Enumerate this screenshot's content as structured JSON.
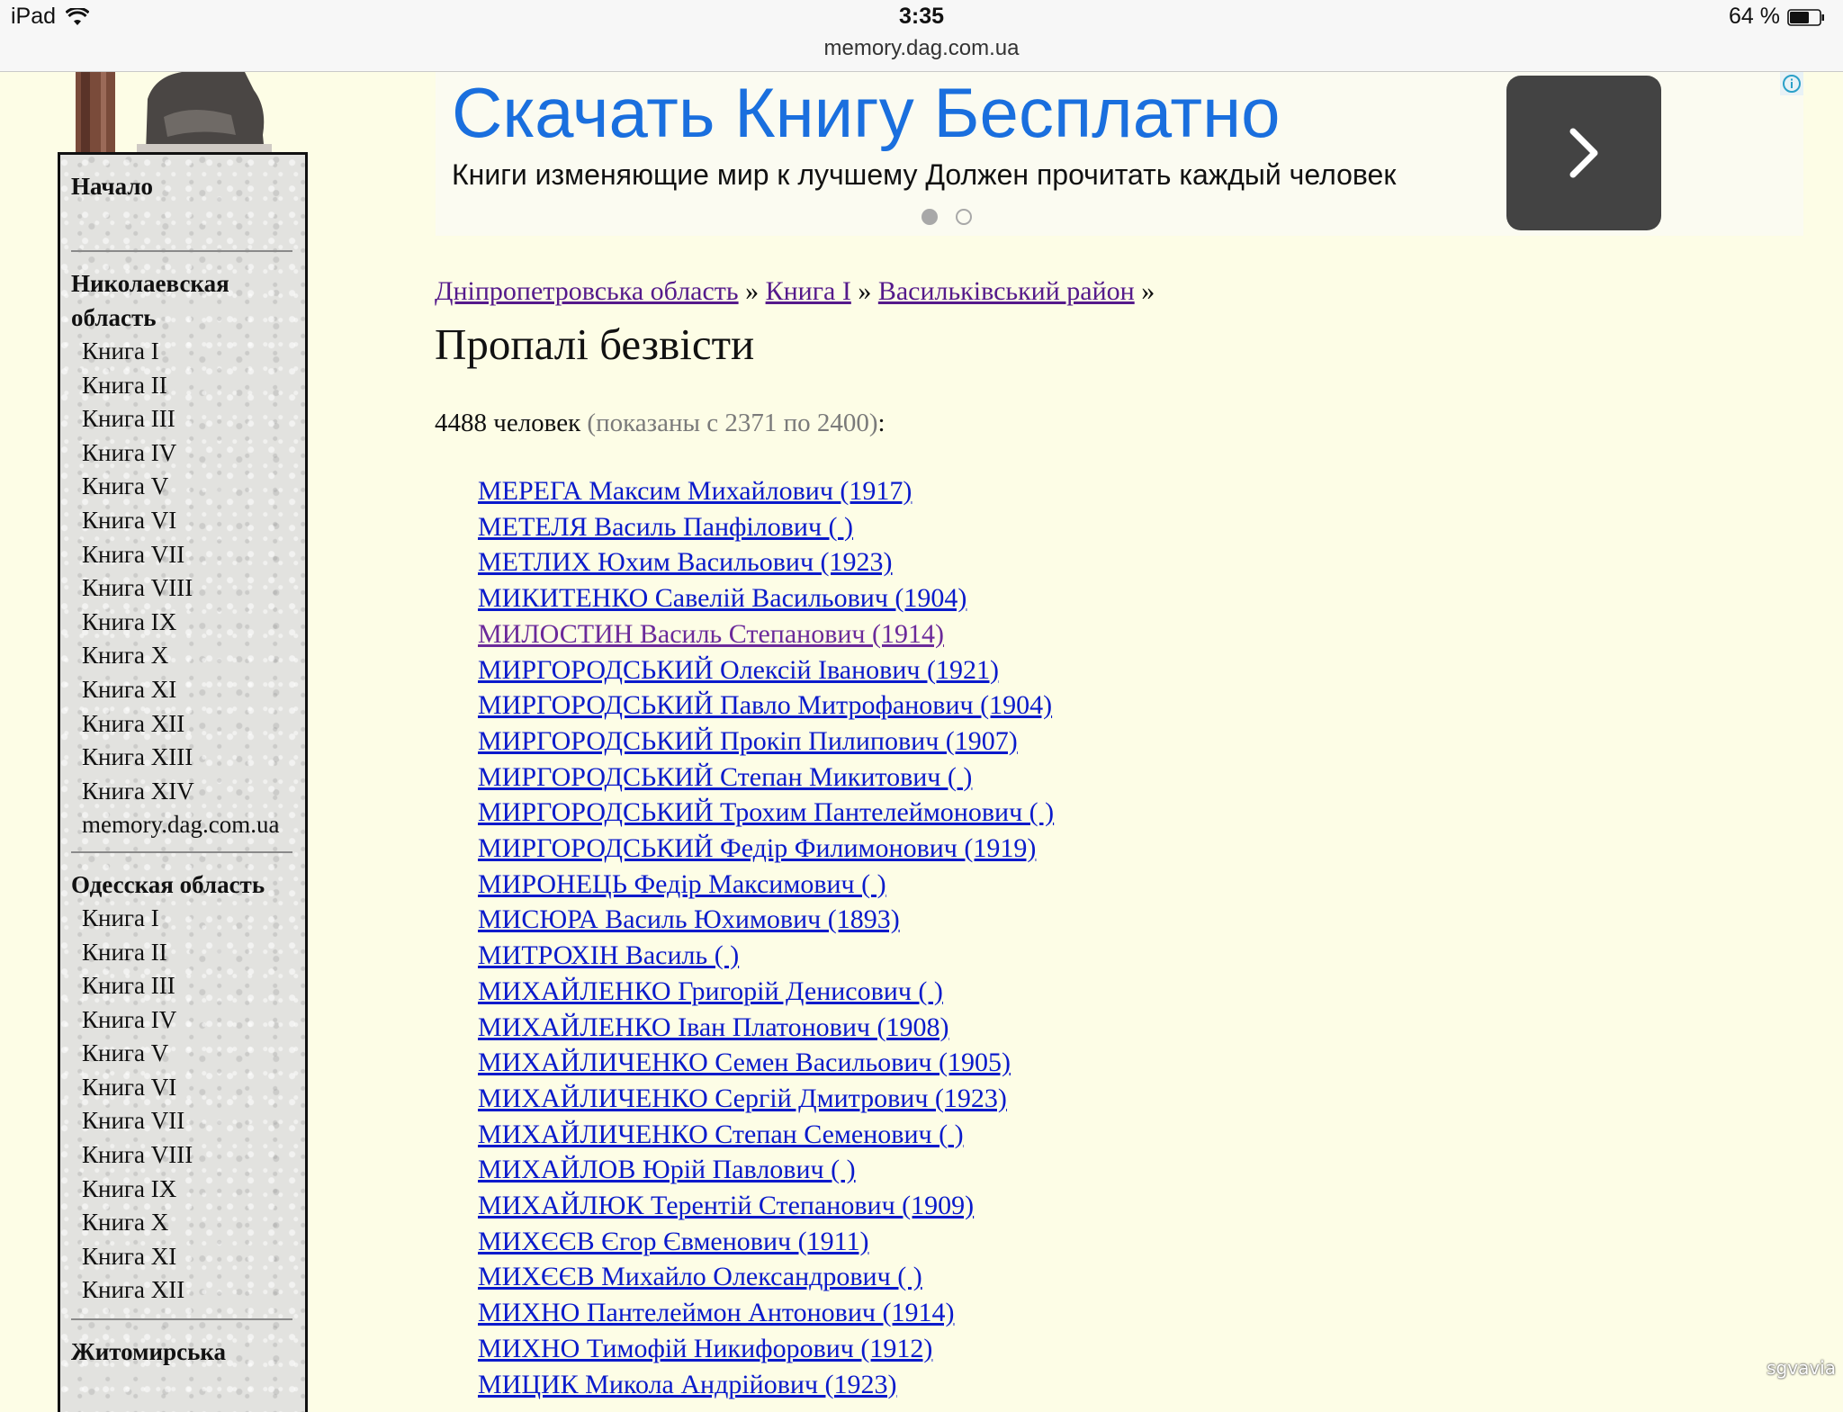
{
  "status_bar": {
    "device": "iPad",
    "time": "3:35",
    "battery": "64 %",
    "url": "memory.dag.com.ua",
    "icons": [
      "wifi-icon",
      "battery-icon"
    ]
  },
  "sidebar": {
    "top_link": "Начало",
    "sections": [
      {
        "title": "Николаевская область",
        "items": [
          "Книга I",
          "Книга II",
          "Книга III",
          "Книга IV",
          "Книга V",
          "Книга VI",
          "Книга VII",
          "Книга VIII",
          "Книга IX",
          "Книга X",
          "Книга XI",
          "Книга XII",
          "Книга XIII",
          "Книга XIV",
          "memory.dag.com.ua"
        ]
      },
      {
        "title": "Одесская область",
        "items": [
          "Книга I",
          "Книга II",
          "Книга III",
          "Книга IV",
          "Книга V",
          "Книга VI",
          "Книга VII",
          "Книга VIII",
          "Книга IX",
          "Книга X",
          "Книга XI",
          "Книга XII"
        ]
      },
      {
        "title": "Житомирська",
        "items": []
      }
    ]
  },
  "ad": {
    "title": "Скачать Книгу Бесплатно",
    "description": "Книги изменяющие мир к лучшему Должен прочитать каждый человек",
    "button_icon": "chevron-right-icon",
    "info_icon": "info-icon",
    "dots_active_index": 0,
    "dots_count": 2
  },
  "breadcrumbs": [
    "Дніпропетровська область",
    "Книга I",
    "Васильківський район"
  ],
  "breadcrumb_separator": "»",
  "page_title": "Пропалі безвісти",
  "count": {
    "total": "4488 человек",
    "range": "(показаны с 2371 по 2400)",
    "suffix": ":"
  },
  "people": [
    "МЕРЕГА Максим Михайлович (1917)",
    "МЕТЕЛЯ Василь Панфілович ( )",
    "МЕТЛИХ Юхим Васильович (1923)",
    "МИКИТЕНКО Савелій Васильович (1904)",
    "МИЛОСТИН Василь Степанович (1914)",
    "МИРГОРОДСЬКИЙ Олексій Іванович (1921)",
    "МИРГОРОДСЬКИЙ Павло Митрофанович (1904)",
    "МИРГОРОДСЬКИЙ Прокіп Пилипович (1907)",
    "МИРГОРОДСЬКИЙ Степан Микитович ( )",
    "МИРГОРОДСЬКИЙ Трохим Пантелеймонович ( )",
    "МИРГОРОДСЬКИЙ Федір Филимонович (1919)",
    "МИРОНЕЦЬ Федір Максимович ( )",
    "МИСЮРА Василь Юхимович (1893)",
    "МИТРОХІН Василь ( )",
    "МИХАЙЛЕНКО Григорій Денисович ( )",
    "МИХАЙЛЕНКО Іван Платонович (1908)",
    "МИХАЙЛИЧЕНКО Семен Васильович (1905)",
    "МИХАЙЛИЧЕНКО Сергій Дмитрович (1923)",
    "МИХАЙЛИЧЕНКО Степан Семенович ( )",
    "МИХАЙЛОВ Юрій Павлович ( )",
    "МИХАЙЛЮК Терентій Степанович (1909)",
    "МИХЄЄВ Єгор Євменович (1911)",
    "МИХЄЄВ Михайло Олександрович ( )",
    "МИХНО Пантелеймон Антонович (1914)",
    "МИХНО Тимофій Никифорович (1912)",
    "МИЦИК Микола Андрійович (1923)"
  ],
  "visited_index": 4,
  "watermark": "sgvavia",
  "colors": {
    "page_bg": "#fdfde6",
    "link": "#0a1acb",
    "visited": "#6b2a9a",
    "ad_title": "#1a6fde",
    "ad_button": "#434343"
  }
}
